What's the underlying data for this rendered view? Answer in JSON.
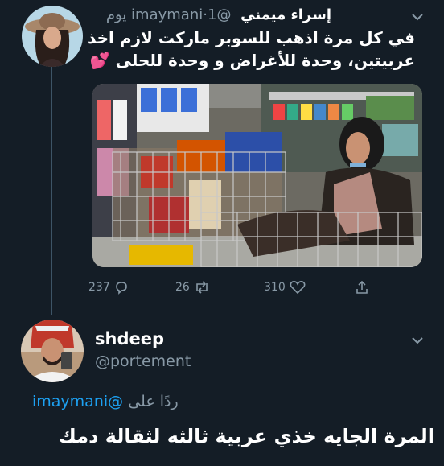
{
  "tweet1": {
    "display_name": "إسراء ميمني",
    "handle": "@imaymani",
    "separator": "·",
    "time": "1 يوم",
    "text_line1": "في كل مرة اذهب للسوبر ماركت لازم اخذ",
    "text_line2": "عربيتين، وحدة للأغراض و وحدة للحلى",
    "emoji": "💕",
    "media_alt": "shopping carts in supermarket",
    "counts": {
      "replies": "237",
      "retweets": "26",
      "likes": "310"
    }
  },
  "tweet2": {
    "display_name": "shdeep",
    "handle": "@portement",
    "reply_prefix": "ردًا على",
    "reply_mention": "@imaymani",
    "text": "المرة الجايه خذي عربية ثالثه لثقالة دمك"
  },
  "colors": {
    "background": "#141d26",
    "secondary_text": "#8899a6",
    "link": "#1da1f2",
    "thread_line": "#3d5466"
  },
  "icons": [
    "chevron-down-icon",
    "reply-icon",
    "retweet-icon",
    "like-icon",
    "share-icon"
  ]
}
